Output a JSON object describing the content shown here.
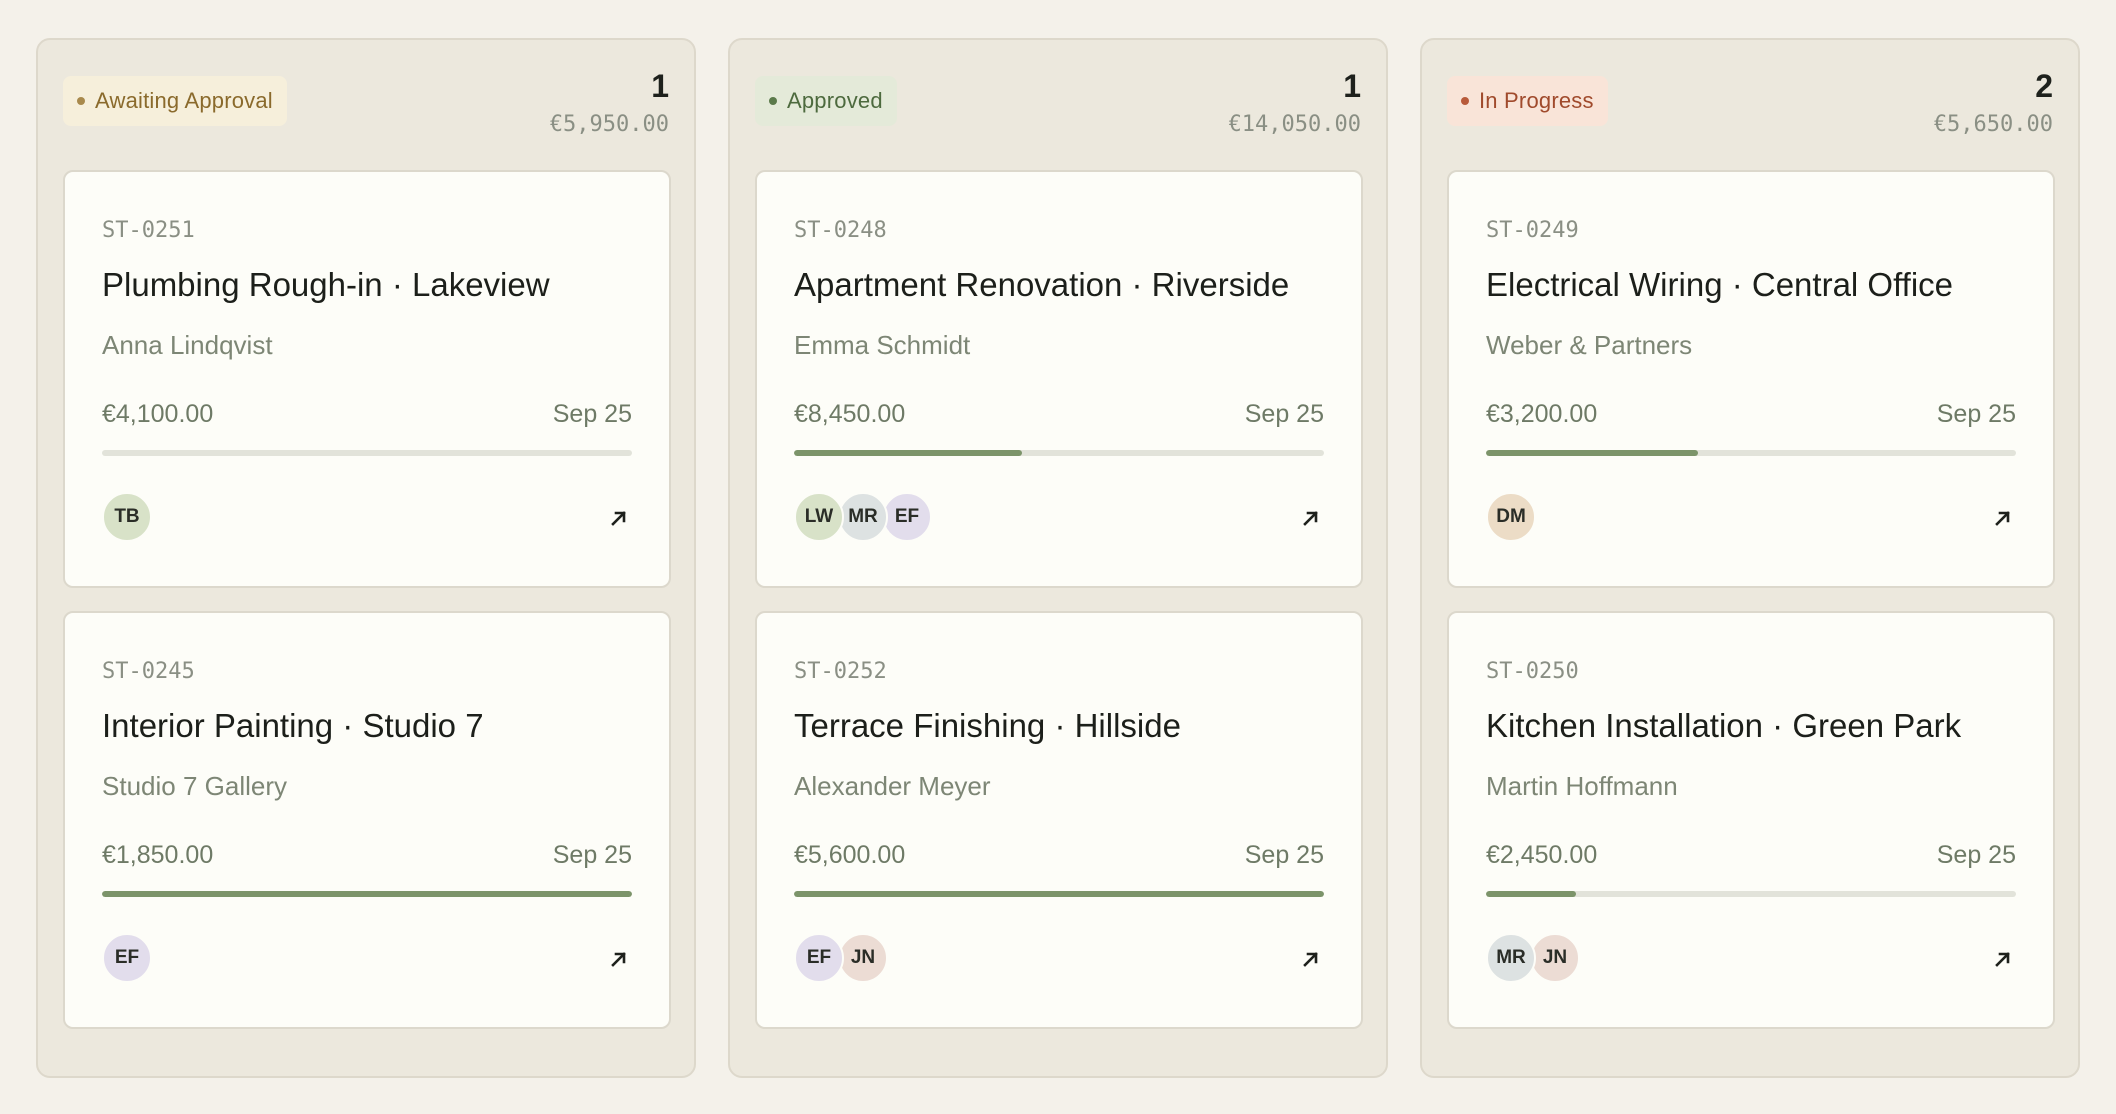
{
  "columns": [
    {
      "status": "Awaiting Approval",
      "pill_bg": "#f6efdb",
      "pill_fg": "#8a6a2c",
      "dot": "#a8894c",
      "count": "1",
      "total": "€5,950.00",
      "cards": [
        {
          "id": "ST-0251",
          "title": "Plumbing Rough-in · Lakeview",
          "client": "Anna Lindqvist",
          "amount": "€4,100.00",
          "date": "Sep 25",
          "progress": 0,
          "avatars": [
            {
              "initials": "TB",
              "color": "#d8e2c8"
            }
          ]
        },
        {
          "id": "ST-0245",
          "title": "Interior Painting · Studio 7",
          "client": "Studio 7 Gallery",
          "amount": "€1,850.00",
          "date": "Sep 25",
          "progress": 1,
          "avatars": [
            {
              "initials": "EF",
              "color": "#e2ddec"
            }
          ]
        }
      ]
    },
    {
      "status": "Approved",
      "pill_bg": "#e4ead9",
      "pill_fg": "#4d6a3e",
      "dot": "#5b7a4b",
      "count": "1",
      "total": "€14,050.00",
      "cards": [
        {
          "id": "ST-0248",
          "title": "Apartment Renovation · Riverside",
          "client": "Emma Schmidt",
          "amount": "€8,450.00",
          "date": "Sep 25",
          "progress": 0.43,
          "avatars": [
            {
              "initials": "LW",
              "color": "#d8e2c8"
            },
            {
              "initials": "MR",
              "color": "#dde2e2"
            },
            {
              "initials": "EF",
              "color": "#e2ddec"
            }
          ]
        },
        {
          "id": "ST-0252",
          "title": "Terrace Finishing · Hillside",
          "client": "Alexander Meyer",
          "amount": "€5,600.00",
          "date": "Sep 25",
          "progress": 1,
          "avatars": [
            {
              "initials": "EF",
              "color": "#e2ddec"
            },
            {
              "initials": "JN",
              "color": "#ecdcd4"
            }
          ]
        }
      ]
    },
    {
      "status": "In Progress",
      "pill_bg": "#f9e4d8",
      "pill_fg": "#a04a2c",
      "dot": "#b85a3a",
      "count": "2",
      "total": "€5,650.00",
      "cards": [
        {
          "id": "ST-0249",
          "title": "Electrical Wiring · Central Office",
          "client": "Weber & Partners",
          "amount": "€3,200.00",
          "date": "Sep 25",
          "progress": 0.4,
          "avatars": [
            {
              "initials": "DM",
              "color": "#ecdcc6"
            }
          ]
        },
        {
          "id": "ST-0250",
          "title": "Kitchen Installation · Green Park",
          "client": "Martin Hoffmann",
          "amount": "€2,450.00",
          "date": "Sep 25",
          "progress": 0.17,
          "avatars": [
            {
              "initials": "MR",
              "color": "#dde2e2"
            },
            {
              "initials": "JN",
              "color": "#ecdcd4"
            }
          ]
        }
      ]
    }
  ],
  "icons": {
    "open": "arrow-up-right-icon"
  }
}
